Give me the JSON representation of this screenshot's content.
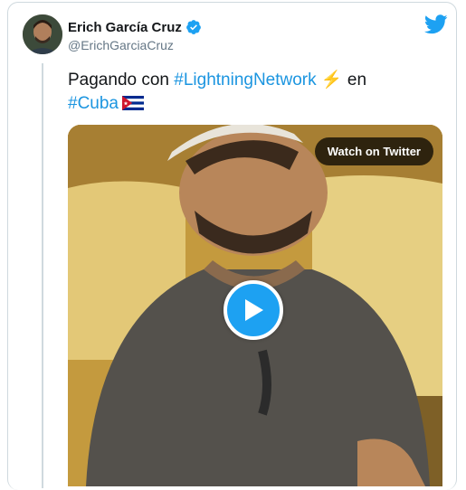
{
  "author": {
    "name": "Erich García Cruz",
    "handle": "@ErichGarciaCruz",
    "verified": true
  },
  "tweet": {
    "text_before": "Pagando con ",
    "hashtag_1": "#LightningNetwork",
    "bolt_emoji": "⚡",
    "text_middle": " en",
    "hashtag_2": "#Cuba",
    "flag_emoji": "cuba-flag"
  },
  "media": {
    "watch_label": "Watch on Twitter",
    "play_icon": "play-icon"
  },
  "colors": {
    "accent": "#1da1f2",
    "hashtag": "#1b95e0",
    "handle": "#657786"
  }
}
